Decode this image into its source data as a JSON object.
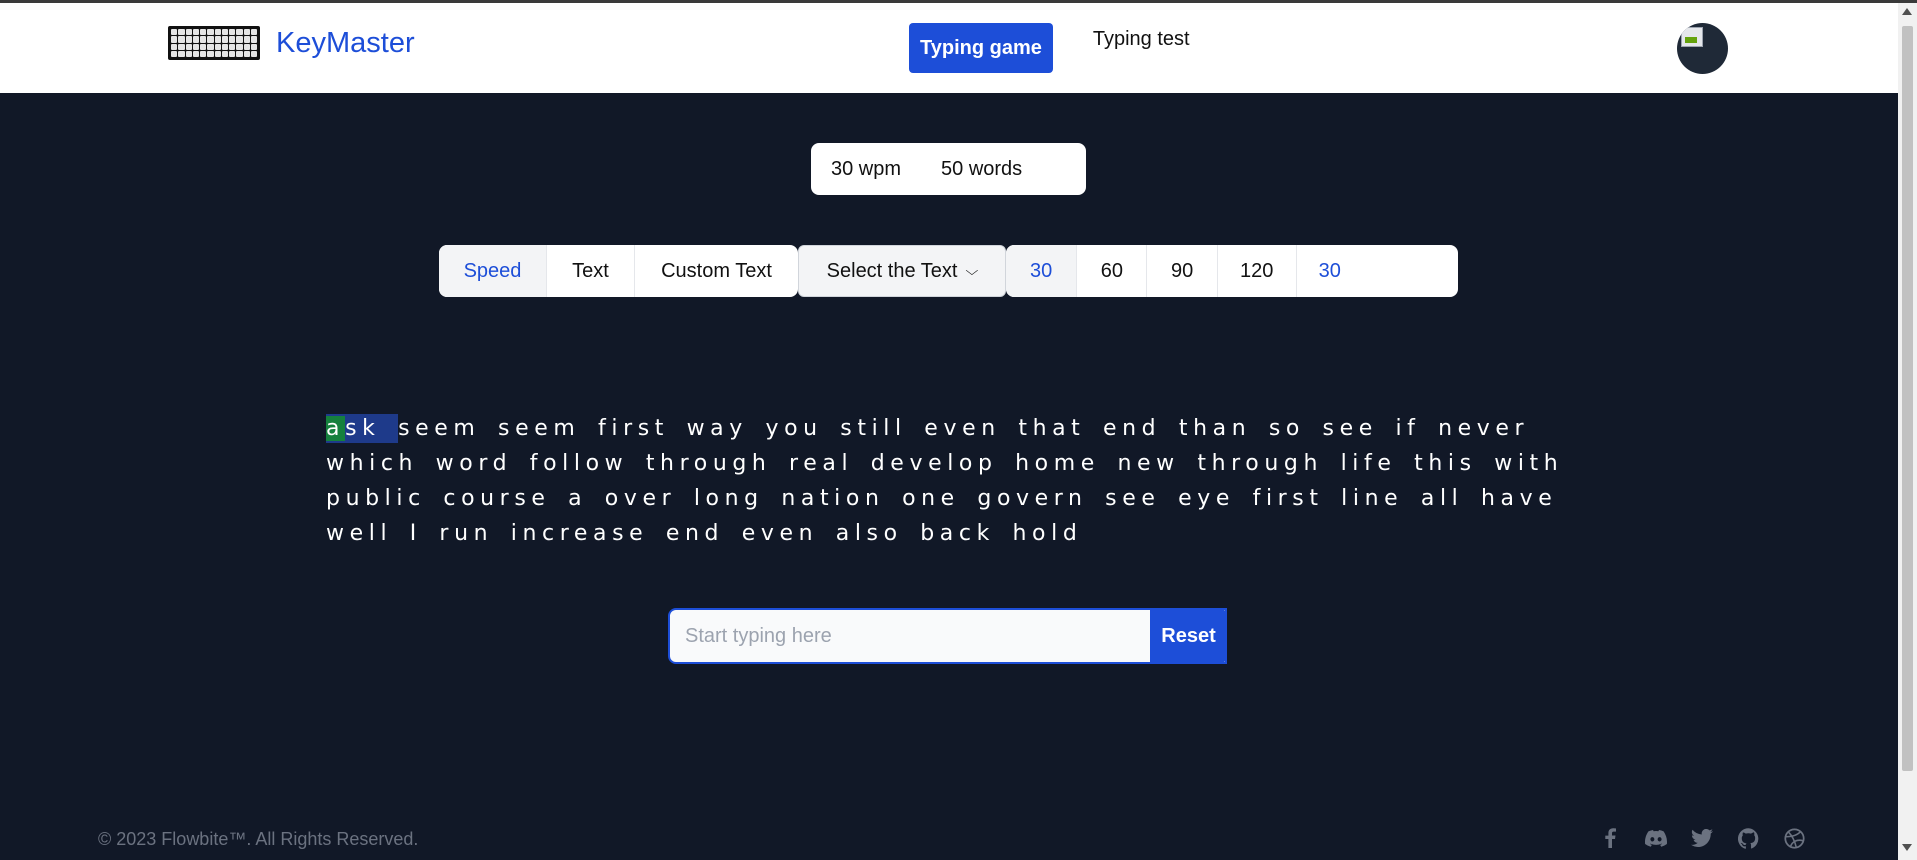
{
  "header": {
    "brand": "KeyMaster",
    "nav": {
      "primary": "Typing game",
      "secondary": "Typing test"
    }
  },
  "stats": {
    "wpm": "30 wpm",
    "words": "50 words"
  },
  "modes": {
    "tabs": [
      "Speed",
      "Text",
      "Custom Text"
    ],
    "active_tab": "Speed",
    "select_text": "Select the Text",
    "durations": [
      "30",
      "60",
      "90",
      "120"
    ],
    "active_duration": "30",
    "custom_value": "30"
  },
  "words": {
    "current_word": "ask",
    "current_correct_letters": "a",
    "current_rest": "sk",
    "remaining": "seem seem first way you still even that end than so see if never which word follow through real develop home new through life this with public course a over long nation one govern see eye first line all have well I run increase end even also back hold"
  },
  "input": {
    "placeholder": "Start typing here",
    "value": ""
  },
  "reset_label": "Reset",
  "footer": {
    "copyright": "© 2023 Flowbite™. All Rights Reserved.",
    "socials": [
      "facebook-icon",
      "discord-icon",
      "twitter-icon",
      "github-icon",
      "dribbble-icon"
    ]
  },
  "colors": {
    "accent": "#1d4ed8",
    "background": "#111827",
    "correct": "#15803d"
  }
}
